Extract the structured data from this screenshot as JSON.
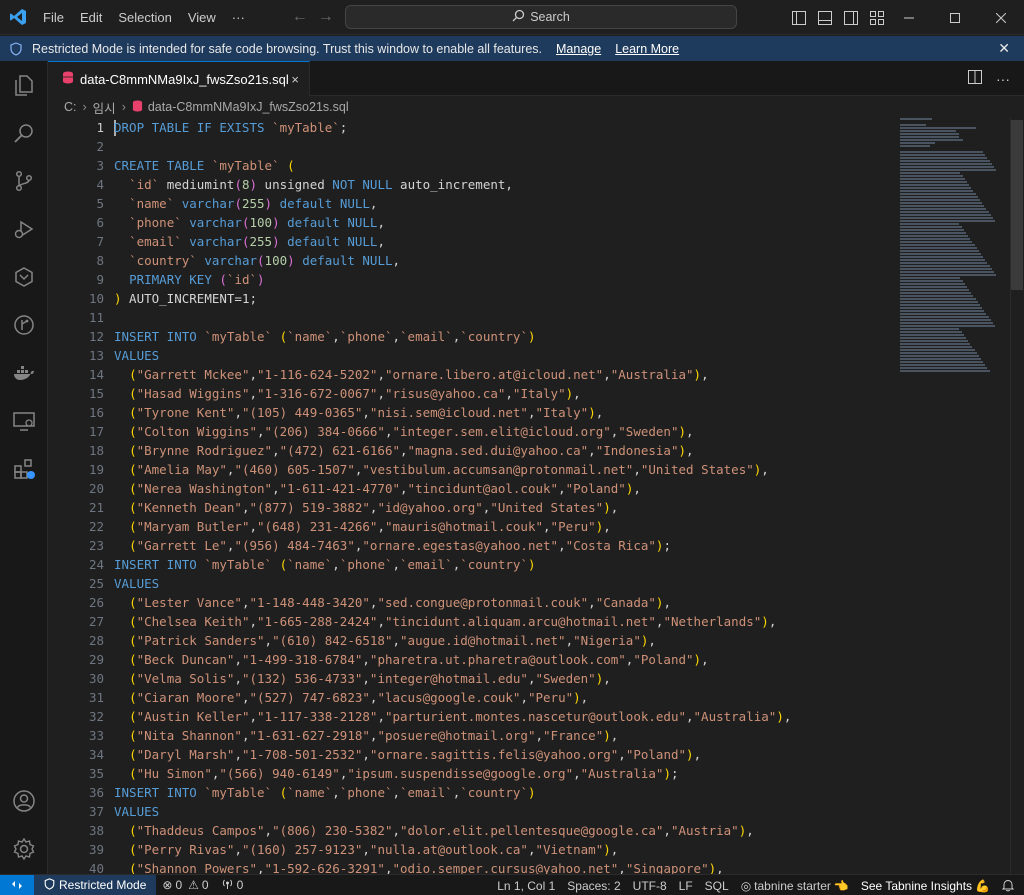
{
  "titlebar": {
    "menu": [
      "File",
      "Edit",
      "Selection",
      "View"
    ],
    "more": "···",
    "search_label": "Search"
  },
  "banner": {
    "message": "Restricted Mode is intended for safe code browsing. Trust this window to enable all features.",
    "manage_link": "Manage",
    "learn_more_link": "Learn More"
  },
  "tab": {
    "filename": "data-C8mmNMa9IxJ_fwsZso21s.sql",
    "close": "×"
  },
  "breadcrumb": {
    "drive": "C:",
    "folder": "임시",
    "file": "data-C8mmNMa9IxJ_fwsZso21s.sql"
  },
  "editor": {
    "line_numbers": [
      "1",
      "2",
      "3",
      "4",
      "5",
      "6",
      "7",
      "8",
      "9",
      "10",
      "11",
      "12",
      "13",
      "14",
      "15",
      "16",
      "17",
      "18",
      "19",
      "20",
      "21",
      "22",
      "23",
      "24",
      "25",
      "26",
      "27",
      "28",
      "29",
      "30",
      "31",
      "32",
      "33",
      "34",
      "35",
      "36",
      "37",
      "38",
      "39",
      "40"
    ],
    "active_line": "1"
  },
  "statusbar": {
    "restricted_mode": "Restricted Mode",
    "errors": "0",
    "warnings": "0",
    "ports": "0",
    "position": "Ln 1, Col 1",
    "spaces": "Spaces: 2",
    "encoding": "UTF-8",
    "eol": "LF",
    "language": "SQL",
    "tabnine": "tabnine starter",
    "tabnine_insights": "See Tabnine Insights"
  },
  "colors": {
    "accent": "#0078d4",
    "banner": "#1e3a5c",
    "keyword": "#569cd6",
    "string": "#ce9178",
    "number": "#b5cea8",
    "paren_gold": "#ffd700"
  }
}
